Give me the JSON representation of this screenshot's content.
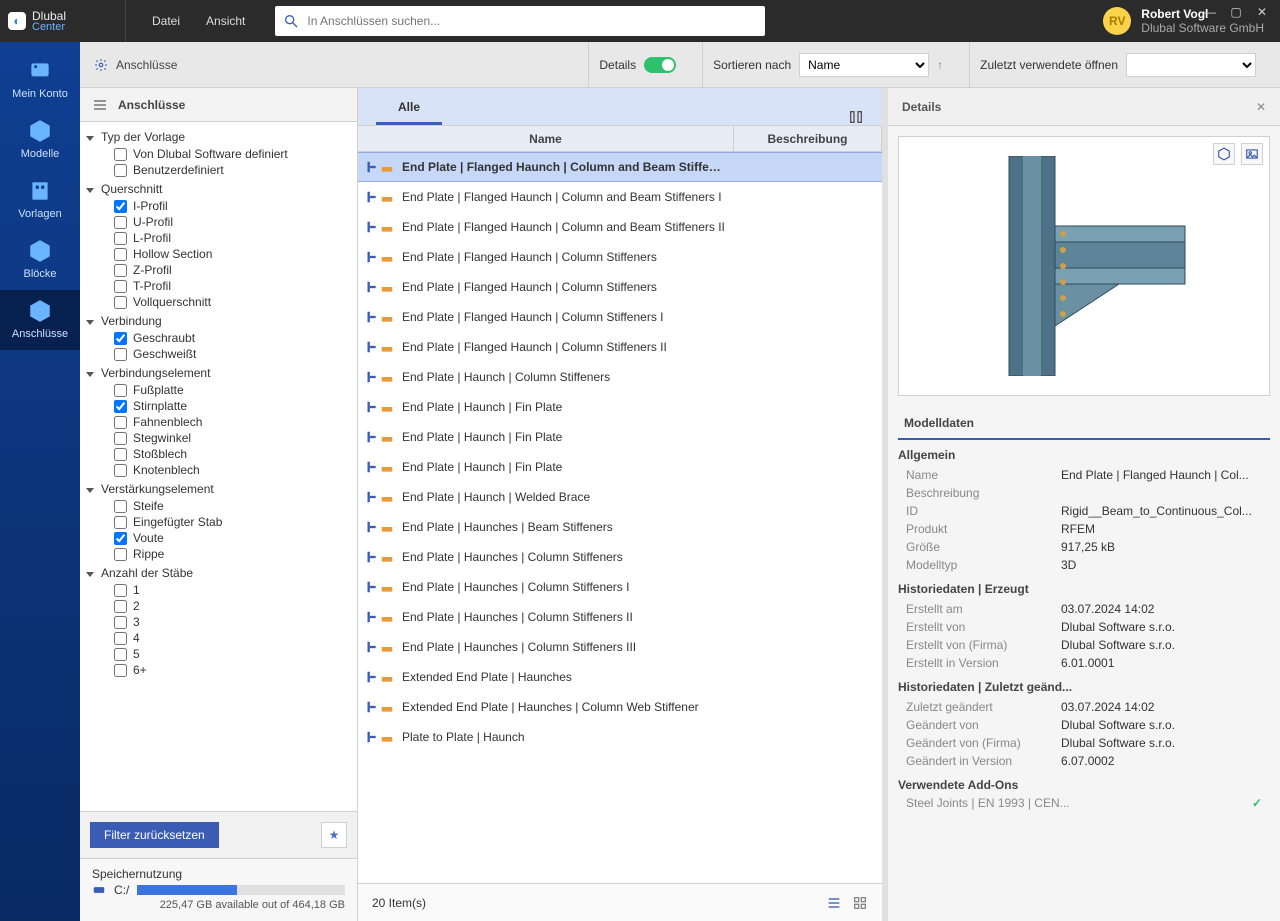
{
  "app": {
    "brand": "Dlubal",
    "sub": "Center"
  },
  "menu": {
    "file": "Datei",
    "view": "Ansicht"
  },
  "search": {
    "placeholder": "In Anschlüssen suchen..."
  },
  "user": {
    "initials": "RV",
    "name": "Robert Vogl",
    "company": "Dlubal Software GmbH"
  },
  "rail": {
    "account": "Mein Konto",
    "models": "Modelle",
    "templates": "Vorlagen",
    "blocks": "Blöcke",
    "connections": "Anschlüsse"
  },
  "crumb": {
    "title": "Anschlüsse",
    "details": "Details",
    "sortby": "Sortieren nach",
    "sortvalue": "Name",
    "recent": "Zuletzt verwendete öffnen"
  },
  "tree": {
    "title": "Anschlüsse",
    "g_type": "Typ der Vorlage",
    "c_type_1": "Von Dlubal Software definiert",
    "c_type_2": "Benutzerdefiniert",
    "g_cs": "Querschnitt",
    "c_cs_1": "I-Profil",
    "c_cs_2": "U-Profil",
    "c_cs_3": "L-Profil",
    "c_cs_4": "Hollow Section",
    "c_cs_5": "Z-Profil",
    "c_cs_6": "T-Profil",
    "c_cs_7": "Vollquerschnitt",
    "g_conn": "Verbindung",
    "c_conn_1": "Geschraubt",
    "c_conn_2": "Geschweißt",
    "g_elem": "Verbindungselement",
    "c_elem_1": "Fußplatte",
    "c_elem_2": "Stirnplatte",
    "c_elem_3": "Fahnenblech",
    "c_elem_4": "Stegwinkel",
    "c_elem_5": "Stoßblech",
    "c_elem_6": "Knotenblech",
    "g_stiff": "Verstärkungselement",
    "c_stiff_1": "Steife",
    "c_stiff_2": "Eingefügter Stab",
    "c_stiff_3": "Voute",
    "c_stiff_4": "Rippe",
    "g_num": "Anzahl der Stäbe",
    "c_num_1": "1",
    "c_num_2": "2",
    "c_num_3": "3",
    "c_num_4": "4",
    "c_num_5": "5",
    "c_num_6": "6+",
    "reset": "Filter zurücksetzen",
    "storage_title": "Speichernutzung",
    "drive": "C:/",
    "storage_text": "225,47 GB available out of 464,18 GB"
  },
  "mid": {
    "tab": "Alle",
    "col_name": "Name",
    "col_desc": "Beschreibung",
    "footer": "20 Item(s)",
    "rows": [
      "End Plate | Flanged Haunch | Column and Beam Stiffeners",
      "End Plate | Flanged Haunch | Column and Beam Stiffeners I",
      "End Plate | Flanged Haunch | Column and Beam Stiffeners II",
      "End Plate | Flanged Haunch | Column Stiffeners",
      "End Plate | Flanged Haunch | Column Stiffeners",
      "End Plate | Flanged Haunch | Column Stiffeners I",
      "End Plate | Flanged Haunch | Column Stiffeners II",
      "End Plate | Haunch | Column Stiffeners",
      "End Plate | Haunch | Fin Plate",
      "End Plate | Haunch | Fin Plate",
      "End Plate | Haunch | Fin Plate",
      "End Plate | Haunch | Welded Brace",
      "End Plate | Haunches | Beam Stiffeners",
      "End Plate | Haunches | Column Stiffeners",
      "End Plate | Haunches | Column Stiffeners I",
      "End Plate | Haunches | Column Stiffeners II",
      "End Plate | Haunches | Column Stiffeners III",
      "Extended End Plate | Haunches",
      "Extended End Plate | Haunches | Column Web Stiffener",
      "Plate to Plate | Haunch"
    ]
  },
  "det": {
    "title": "Details",
    "section": "Modelldaten",
    "g_general": "Allgemein",
    "k_name": "Name",
    "v_name": "End Plate | Flanged Haunch | Col...",
    "k_desc": "Beschreibung",
    "v_desc": "",
    "k_id": "ID",
    "v_id": "Rigid__Beam_to_Continuous_Col...",
    "k_prod": "Produkt",
    "v_prod": "RFEM",
    "k_size": "Größe",
    "v_size": "917,25 kB",
    "k_mtype": "Modelltyp",
    "v_mtype": "3D",
    "g_created": "Historiedaten | Erzeugt",
    "k_c_at": "Erstellt am",
    "v_c_at": "03.07.2024 14:02",
    "k_c_by": "Erstellt von",
    "v_c_by": "Dlubal Software s.r.o.",
    "k_c_comp": "Erstellt von (Firma)",
    "v_c_comp": "Dlubal Software s.r.o.",
    "k_c_ver": "Erstellt in Version",
    "v_c_ver": "6.01.0001",
    "g_mod": "Historiedaten | Zuletzt geänd...",
    "k_m_at": "Zuletzt geändert",
    "v_m_at": "03.07.2024 14:02",
    "k_m_by": "Geändert von",
    "v_m_by": "Dlubal Software s.r.o.",
    "k_m_comp": "Geändert von (Firma)",
    "v_m_comp": "Dlubal Software s.r.o.",
    "k_m_ver": "Geändert in Version",
    "v_m_ver": "6.07.0002",
    "g_addons": "Verwendete Add-Ons",
    "addon_line": "Steel Joints | EN 1993 | CEN..."
  }
}
